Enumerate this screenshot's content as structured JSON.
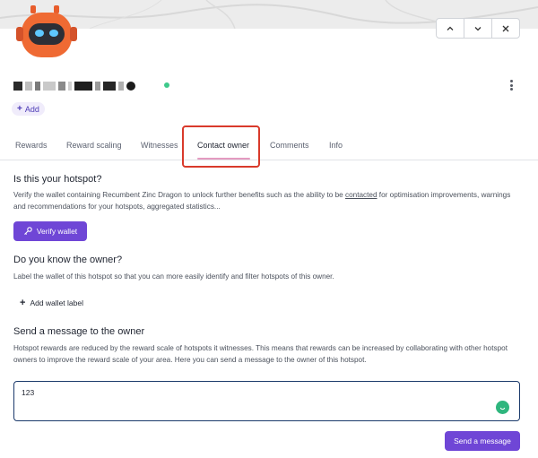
{
  "window_controls": {
    "up": "up",
    "down": "down",
    "close": "close"
  },
  "hotspot": {
    "status_color": "#3ec98b"
  },
  "add_chip": {
    "plus": "+",
    "label": "Add"
  },
  "tabs": [
    {
      "label": "Rewards"
    },
    {
      "label": "Reward scaling"
    },
    {
      "label": "Witnesses"
    },
    {
      "label": "Contact owner",
      "active": true
    },
    {
      "label": "Comments"
    },
    {
      "label": "Info"
    }
  ],
  "sections": {
    "hotspot": {
      "title": "Is this your hotspot?",
      "desc_before": "Verify the wallet containing Recumbent Zinc Dragon to unlock further benefits such as the ability to be ",
      "desc_link": "contacted",
      "desc_after": " for optimisation improvements, warnings and recommendations for your hotspots, aggregated statistics...",
      "button": "Verify wallet"
    },
    "owner": {
      "title": "Do you know the owner?",
      "desc": "Label the wallet of this hotspot so that you can more easily identify and filter hotspots of this owner.",
      "add_label": "Add wallet label",
      "plus": "+"
    },
    "message": {
      "title": "Send a message to the owner",
      "desc": "Hotspot rewards are reduced by the reward scale of hotspots it witnesses. This means that rewards can be increased by collaborating with other hotspot owners to improve the reward scale of your area. Here you can send a message to the owner of this hotspot.",
      "value": "123",
      "button": "Send a message"
    }
  },
  "colors": {
    "accent": "#6f46d6",
    "tab_underline": "#e49ac0",
    "highlight": "#d93a2b",
    "input_border": "#1b3a6b"
  }
}
